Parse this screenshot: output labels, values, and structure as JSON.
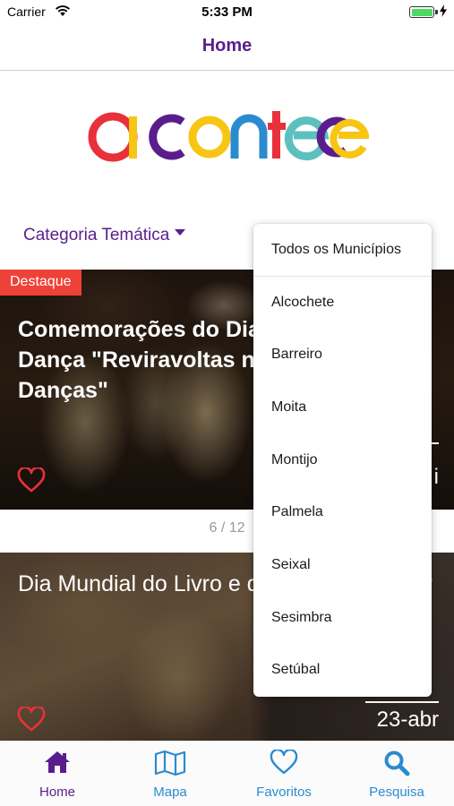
{
  "status_bar": {
    "carrier": "Carrier",
    "time": "5:33 PM",
    "battery_level": 1.0
  },
  "nav": {
    "title": "Home"
  },
  "logo": {
    "text": "acontece"
  },
  "filter": {
    "category_label": "Categoria Temática"
  },
  "dropdown": {
    "items": [
      "Todos os Municípios",
      "Alcochete",
      "Barreiro",
      "Moita",
      "Montijo",
      "Palmela",
      "Seixal",
      "Sesimbra",
      "Setúbal"
    ]
  },
  "featured": {
    "badge": "Destaque",
    "title": "Comemorações do Dia Mundial da Dança \"Reviravoltas nas Nossas Danças\"",
    "date_partial": "i"
  },
  "pager": {
    "text": "6 / 12"
  },
  "event2": {
    "title": "Dia Mundial do Livro e do Direito de Autor",
    "date": "23-abr"
  },
  "tabs": [
    {
      "label": "Home",
      "icon": "home-icon"
    },
    {
      "label": "Mapa",
      "icon": "map-icon"
    },
    {
      "label": "Favoritos",
      "icon": "heart-icon"
    },
    {
      "label": "Pesquisa",
      "icon": "search-icon"
    }
  ],
  "colors": {
    "brand_purple": "#5a1e8c",
    "tab_blue": "#2b8bd0",
    "badge_red": "#ee4138",
    "heart_red": "#e8313a"
  }
}
